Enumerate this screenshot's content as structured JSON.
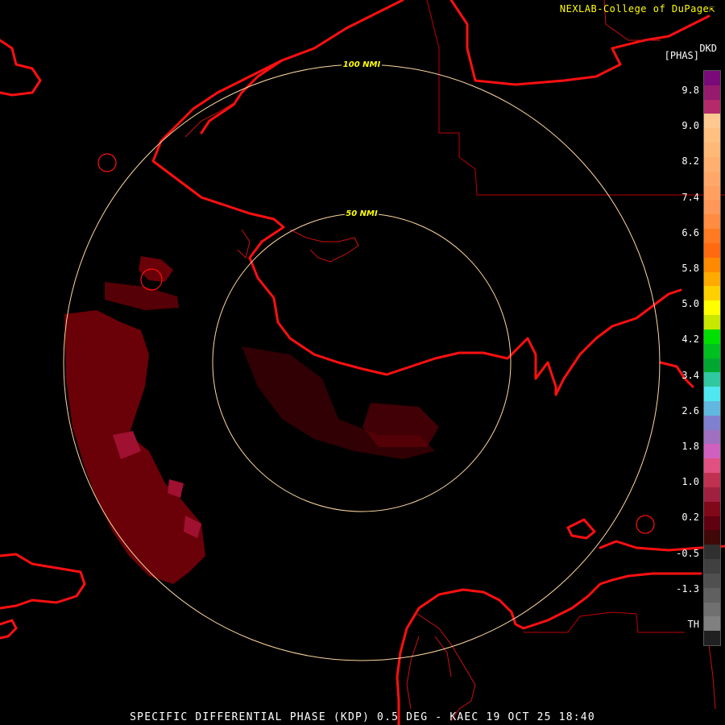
{
  "header": {
    "credit": "NEXLAB-College of DuPage",
    "credit_icon": "arrow-cursor-icon"
  },
  "legend": {
    "product_code": "DKD",
    "unit": "[PHAS]",
    "ticks": [
      "9.8",
      "9.0",
      "8.2",
      "7.4",
      "6.6",
      "5.8",
      "5.0",
      "4.2",
      "3.4",
      "2.6",
      "1.8",
      "1.0",
      "0.2",
      "-0.5",
      "-1.3",
      "TH"
    ],
    "colors": [
      "#7a0a7a",
      "#961a6e",
      "#b42a6a",
      "#ffc890",
      "#ffc080",
      "#ffb878",
      "#ffb070",
      "#ffa86a",
      "#ffa060",
      "#ff9858",
      "#ff8c40",
      "#ff7a20",
      "#ff6a10",
      "#ff8a00",
      "#ffaa00",
      "#ffd000",
      "#ffff00",
      "#c8e800",
      "#00e000",
      "#00c020",
      "#00a830",
      "#30c8a0",
      "#50e8f0",
      "#60b8e0",
      "#8080d0",
      "#a070c0",
      "#d060c0",
      "#e05080",
      "#c03050",
      "#a02040",
      "#800818",
      "#600010",
      "#400808",
      "#303030",
      "#404040",
      "#505050",
      "#606060",
      "#707070",
      "#808080",
      "#202020"
    ]
  },
  "range_rings": [
    "100 NMI",
    "50 NMI"
  ],
  "footer": {
    "caption": "SPECIFIC DIFFERENTIAL PHASE (KDP) 0.5 DEG - KAEC 19 OCT 25 18:40"
  }
}
